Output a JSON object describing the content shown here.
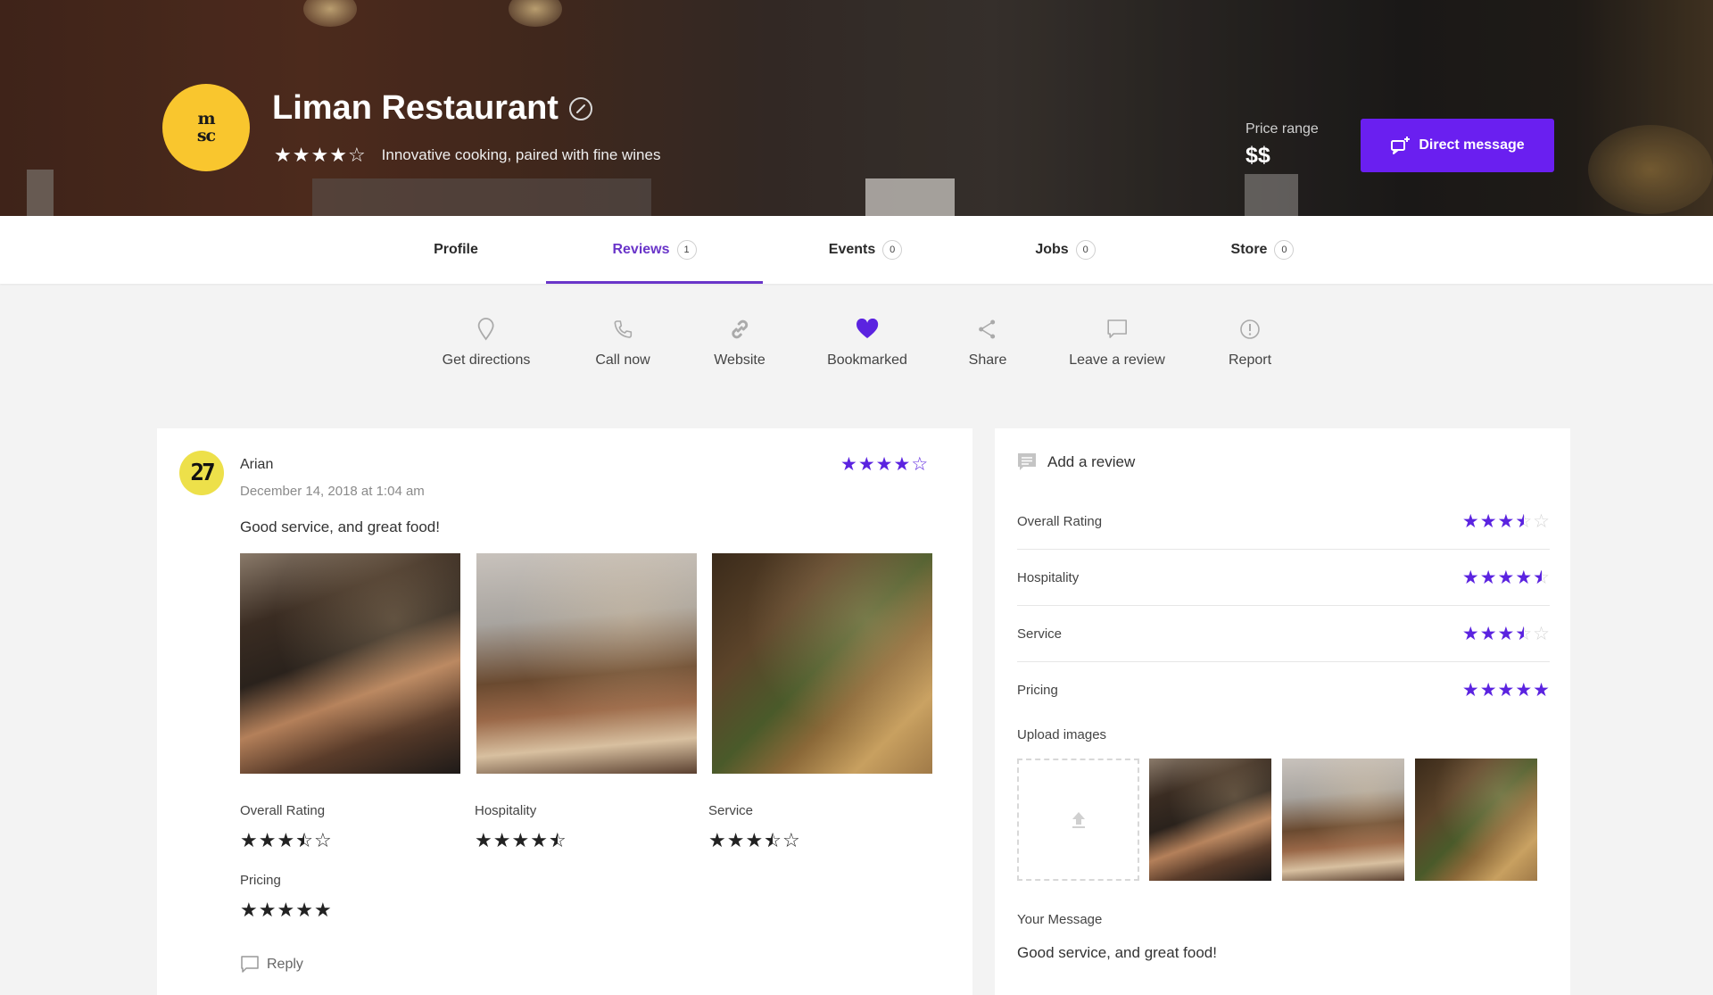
{
  "header": {
    "logo_text_top": "m",
    "logo_text_bottom": "sc",
    "title": "Liman Restaurant",
    "rating": 4,
    "rating_max": 5,
    "tagline": "Innovative cooking, paired with fine wines",
    "price_label": "Price range",
    "price_value": "$$",
    "direct_message_label": "Direct message"
  },
  "tabs": [
    {
      "label": "Profile",
      "count": null,
      "active": false
    },
    {
      "label": "Reviews",
      "count": "1",
      "active": true
    },
    {
      "label": "Events",
      "count": "0",
      "active": false
    },
    {
      "label": "Jobs",
      "count": "0",
      "active": false
    },
    {
      "label": "Store",
      "count": "0",
      "active": false
    }
  ],
  "actions": [
    {
      "label": "Get directions",
      "icon": "map-pin-icon"
    },
    {
      "label": "Call now",
      "icon": "phone-icon"
    },
    {
      "label": "Website",
      "icon": "link-icon"
    },
    {
      "label": "Bookmarked",
      "icon": "heart-icon"
    },
    {
      "label": "Share",
      "icon": "share-icon"
    },
    {
      "label": "Leave a review",
      "icon": "comment-icon"
    },
    {
      "label": "Report",
      "icon": "alert-icon"
    }
  ],
  "review": {
    "avatar_text": "27",
    "author": "Arian",
    "date": "December 14, 2018 at 1:04 am",
    "rating": 4,
    "text": "Good service, and great food!",
    "photos": [
      "restaurant-interior",
      "table-with-food",
      "woman-dining"
    ],
    "subratings": [
      {
        "label": "Overall Rating",
        "value": 3.5
      },
      {
        "label": "Hospitality",
        "value": 4.5
      },
      {
        "label": "Service",
        "value": 3.5
      },
      {
        "label": "Pricing",
        "value": 5
      }
    ],
    "reply_label": "Reply"
  },
  "review_form": {
    "title": "Add a review",
    "ratings": [
      {
        "label": "Overall Rating",
        "value": 3.5
      },
      {
        "label": "Hospitality",
        "value": 4.5
      },
      {
        "label": "Service",
        "value": 3.5
      },
      {
        "label": "Pricing",
        "value": 5
      }
    ],
    "upload_label": "Upload images",
    "message_label": "Your Message",
    "message_value": "Good service, and great food!"
  },
  "colors": {
    "accent": "#6a1ff0",
    "star_purple": "#5b23e0",
    "tab_active": "#6a35c9",
    "logo_yellow": "#f9c62e"
  }
}
